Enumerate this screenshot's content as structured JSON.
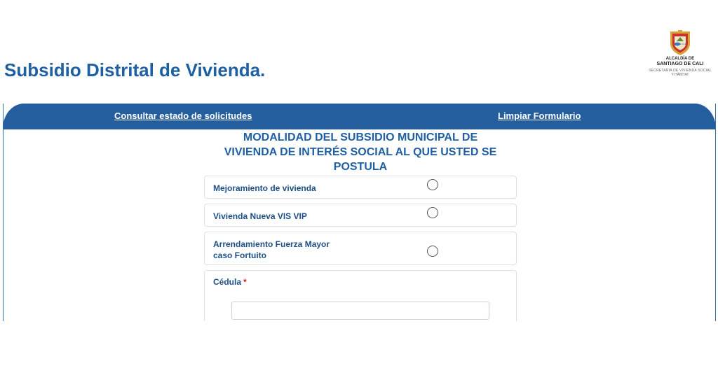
{
  "page": {
    "title": "Subsidio Distrital de Vivienda."
  },
  "logo": {
    "line1": "ALCALDÍA DE",
    "line2": "SANTIAGO DE CALI",
    "line3": "SECRETARÍA DE VIVIENDA SOCIAL",
    "line4": "Y HÁBITAT",
    "colors": {
      "shield_red": "#c8332b",
      "shield_gold": "#d9a33a",
      "shield_blue": "#3f78b8"
    }
  },
  "header": {
    "consultar_link": "Consultar estado de solicitudes",
    "limpiar_link": "Limpiar Formulario",
    "background_color": "#245e9e"
  },
  "form": {
    "section_title_line1": "MODALIDAD DEL SUBSIDIO MUNICIPAL DE",
    "section_title_line2": "VIVIENDA DE INTERÉS SOCIAL AL QUE USTED SE",
    "section_title_line3": "POSTULA",
    "options": [
      {
        "label": "Mejoramiento de vivienda",
        "selected": false
      },
      {
        "label": "Vivienda Nueva VIS VIP",
        "selected": false
      },
      {
        "label_line1": "Arrendamiento Fuerza Mayor",
        "label_line2": "caso Fortuito",
        "selected": false
      }
    ],
    "cedula": {
      "label": "Cédula",
      "required_mark": "*",
      "value": ""
    },
    "accent_color": "#1f5fa4"
  }
}
